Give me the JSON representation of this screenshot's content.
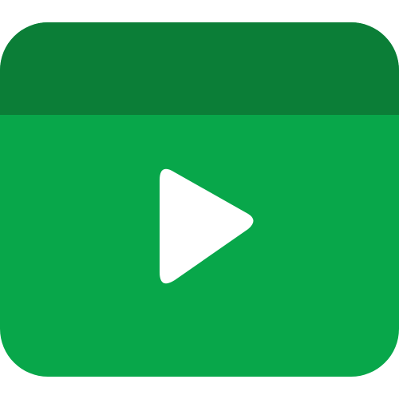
{
  "icon": {
    "name": "video-player-icon",
    "colors": {
      "header_bar": "#0B7E37",
      "body": "#08A74A",
      "play_button": "#FFFFFF"
    }
  }
}
